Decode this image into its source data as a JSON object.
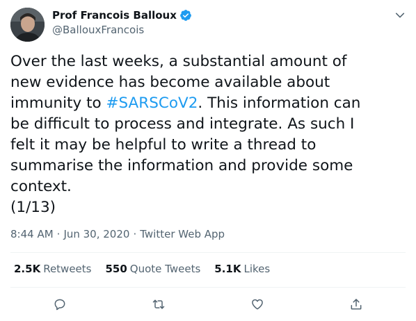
{
  "author": {
    "display_name": "Prof Francois Balloux",
    "handle": "@BallouxFrancois",
    "verified": true
  },
  "tweet": {
    "lines": [
      "Over the last weeks, a substantial amount of",
      "new evidence has become available about",
      "immunity to ",
      "be difficult to process and integrate. As such I",
      "felt it may be helpful to write a thread to",
      "summarise the information and provide some",
      "context.",
      "(1/13)"
    ],
    "hashtag": "#SARSCoV2",
    "after_hashtag": ". This information can"
  },
  "meta": {
    "time": "8:44 AM",
    "date": "Jun 30, 2020",
    "source": "Twitter Web App",
    "separator": "·"
  },
  "stats": {
    "retweets": {
      "count": "2.5K",
      "label": "Retweets"
    },
    "quote_tweets": {
      "count": "550",
      "label": "Quote Tweets"
    },
    "likes": {
      "count": "5.1K",
      "label": "Likes"
    }
  },
  "icons": {
    "reply": "reply-icon",
    "retweet": "retweet-icon",
    "like": "heart-icon",
    "share": "share-icon",
    "more": "chevron-down-icon",
    "verified": "verified-badge-icon"
  },
  "colors": {
    "link": "#1d9bf0",
    "secondary_text": "#536471",
    "divider": "#eff3f4",
    "icon": "#536471"
  }
}
